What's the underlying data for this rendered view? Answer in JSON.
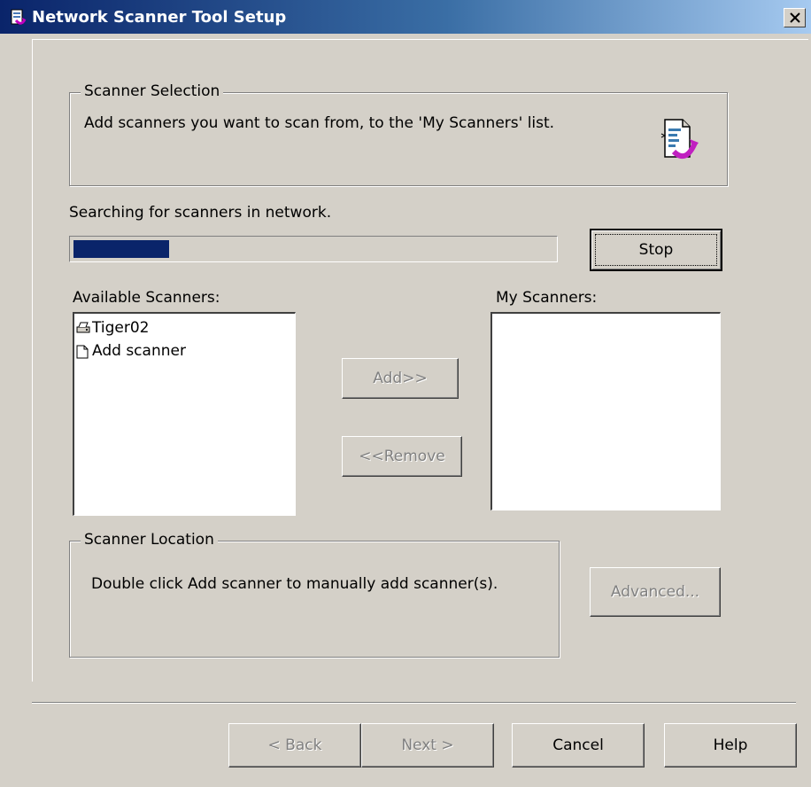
{
  "window": {
    "title": "Network Scanner Tool Setup",
    "accent_color": "#0a246a"
  },
  "scanner_selection": {
    "legend": "Scanner Selection",
    "description": "Add scanners you want to scan from, to the 'My Scanners' list.",
    "icon": "document-arrow-icon"
  },
  "search": {
    "status": "Searching for scanners in network.",
    "progress_percent": 20,
    "stop_label": "Stop"
  },
  "available": {
    "label": "Available Scanners:",
    "items": [
      {
        "icon": "scanner-icon",
        "label": "Tiger02"
      },
      {
        "icon": "document-icon",
        "label": "Add scanner"
      }
    ]
  },
  "actions": {
    "add_label": "Add>>",
    "remove_label": "<<Remove"
  },
  "my_scanners": {
    "label": "My Scanners:",
    "items": []
  },
  "location": {
    "legend": "Scanner Location",
    "hint": "Double click Add scanner to manually add scanner(s).",
    "advanced_label": "Advanced..."
  },
  "footer": {
    "back_label": "< Back",
    "next_label": "Next >",
    "cancel_label": "Cancel",
    "help_label": "Help"
  }
}
